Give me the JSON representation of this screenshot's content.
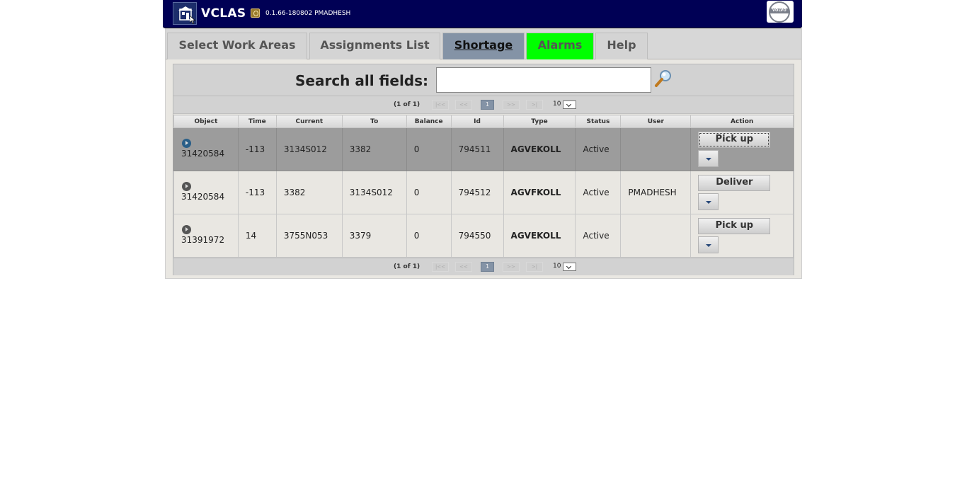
{
  "header": {
    "title": "VCLAS",
    "version": "0.1.66-180802 PMADHESH",
    "logo_text": "VOLVO"
  },
  "tabs": [
    {
      "label": "Select Work Areas",
      "state": "normal"
    },
    {
      "label": "Assignments List",
      "state": "normal"
    },
    {
      "label": "Shortage",
      "state": "active"
    },
    {
      "label": "Alarms",
      "state": "alarm"
    },
    {
      "label": "Help",
      "state": "normal"
    }
  ],
  "colors": {
    "header_bg": "#000055",
    "active_tab": "#8493a6",
    "alarm_tab": "#00ff00",
    "selected_row": "#9c9c9c"
  },
  "search": {
    "label": "Search all fields:",
    "value": "",
    "placeholder": ""
  },
  "pager": {
    "info": "(1 of 1)",
    "current_page": "1",
    "rows_per_page": "10",
    "first": "|<<",
    "prev": "<<",
    "next": ">>",
    "last": ">|"
  },
  "table": {
    "columns": [
      "Object",
      "Time",
      "Current",
      "To",
      "Balance",
      "Id",
      "Type",
      "Status",
      "User",
      "Action"
    ],
    "rows": [
      {
        "object": "31420584",
        "time": "-113",
        "current": "3134S012",
        "to": "3382",
        "balance": "0",
        "id": "794511",
        "type": "AGVEKOLL",
        "status": "Active",
        "user": "",
        "action": "Pick up",
        "selected": true
      },
      {
        "object": "31420584",
        "time": "-113",
        "current": "3382",
        "to": "3134S012",
        "balance": "0",
        "id": "794512",
        "type": "AGVFKOLL",
        "status": "Active",
        "user": "PMADHESH",
        "action": "Deliver",
        "selected": false
      },
      {
        "object": "31391972",
        "time": "14",
        "current": "3755N053",
        "to": "3379",
        "balance": "0",
        "id": "794550",
        "type": "AGVEKOLL",
        "status": "Active",
        "user": "",
        "action": "Pick up",
        "selected": false
      }
    ]
  }
}
